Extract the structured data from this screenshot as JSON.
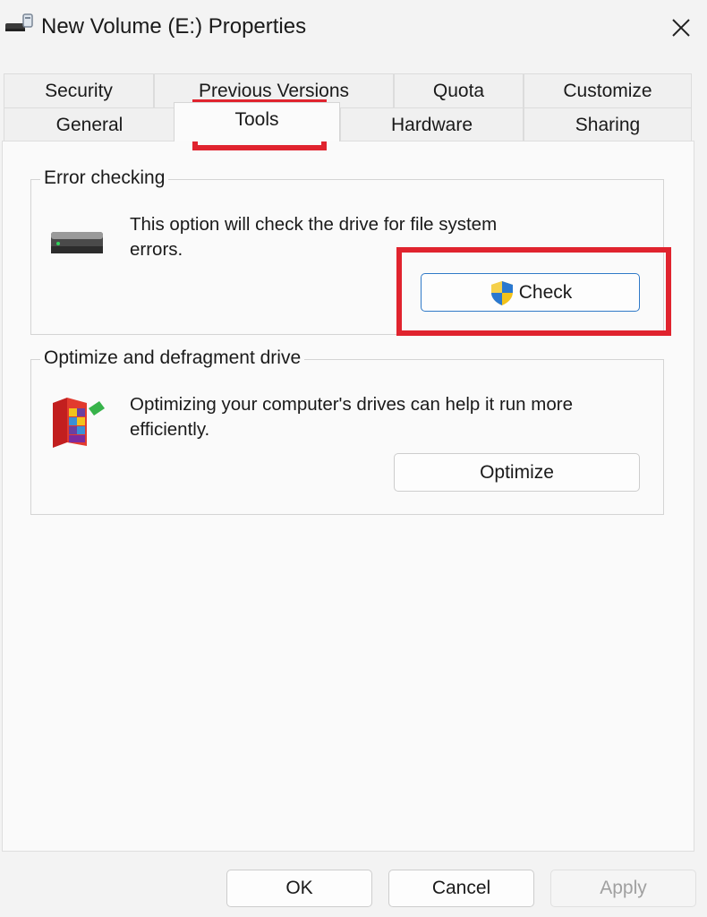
{
  "window": {
    "title": "New Volume (E:) Properties",
    "title_icon": "drive-icon",
    "close_icon": "close-icon"
  },
  "tabs": {
    "row1": [
      {
        "label": "Security"
      },
      {
        "label": "Previous Versions"
      },
      {
        "label": "Quota"
      },
      {
        "label": "Customize"
      }
    ],
    "row2": [
      {
        "label": "General"
      },
      {
        "label": "Tools",
        "active": true
      },
      {
        "label": "Hardware"
      },
      {
        "label": "Sharing"
      }
    ]
  },
  "error_checking": {
    "title": "Error checking",
    "icon": "hard-drive-icon",
    "description_line1": "This option will check the drive for file system",
    "description_line2": "errors.",
    "button_label": "Check",
    "button_icon": "uac-shield-icon"
  },
  "optimize": {
    "title": "Optimize and defragment drive",
    "icon": "defrag-icon",
    "description_line1": "Optimizing your computer's drives can help it run more",
    "description_line2": "efficiently.",
    "button_label": "Optimize"
  },
  "footer": {
    "ok_label": "OK",
    "cancel_label": "Cancel",
    "apply_label": "Apply"
  },
  "colors": {
    "highlight": "#e0232e",
    "focus": "#2f79c7"
  }
}
